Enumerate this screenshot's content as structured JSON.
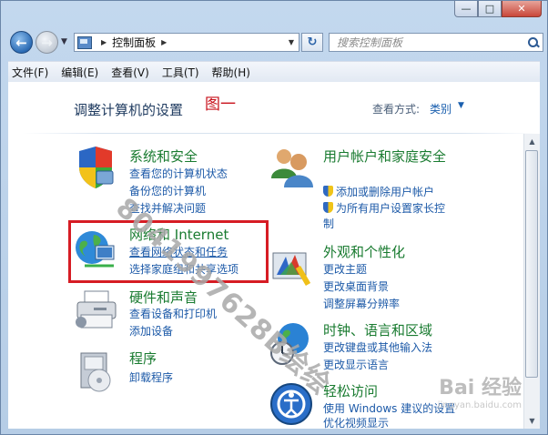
{
  "window": {
    "caption_buttons": [
      "—",
      "□",
      "✕"
    ]
  },
  "nav": {
    "back_icon": "back-arrow-icon",
    "forward_icon": "forward-arrow-icon",
    "address": "控制面板",
    "search_placeholder": "搜索控制面板"
  },
  "menu": [
    "文件(F)",
    "编辑(E)",
    "查看(V)",
    "工具(T)",
    "帮助(H)"
  ],
  "main": {
    "title": "调整计算机的设置",
    "figure_label": "图一",
    "view_by_label": "查看方式:",
    "view_by_value": "类别"
  },
  "categories_left": [
    {
      "title": "系统和安全",
      "icon": "shield-icon",
      "links": [
        "查看您的计算机状态",
        "备份您的计算机",
        "查找并解决问题"
      ]
    },
    {
      "title": "网络和 Internet",
      "icon": "network-globe-icon",
      "links": [
        "查看网络状态和任务",
        "选择家庭组和共享选项"
      ]
    },
    {
      "title": "硬件和声音",
      "icon": "printer-icon",
      "links": [
        "查看设备和打印机",
        "添加设备"
      ]
    },
    {
      "title": "程序",
      "icon": "programs-icon",
      "links": [
        "卸载程序"
      ]
    }
  ],
  "categories_right": [
    {
      "title": "用户帐户和家庭安全",
      "icon": "users-icon",
      "links": [
        "添加或删除用户帐户",
        "为所有用户设置家长控制"
      ]
    },
    {
      "title": "外观和个性化",
      "icon": "appearance-icon",
      "links": [
        "更改主题",
        "更改桌面背景",
        "调整屏幕分辨率"
      ]
    },
    {
      "title": "时钟、语言和区域",
      "icon": "clock-globe-icon",
      "links": [
        "更改键盘或其他输入法",
        "更改显示语言"
      ]
    },
    {
      "title": "轻松访问",
      "icon": "ease-of-access-icon",
      "links": [
        "使用 Windows 建议的设置",
        "优化视频显示"
      ]
    }
  ],
  "watermark": {
    "diagonal": "8041997628B绘绘",
    "baidu": "Bai 经验",
    "baidu_url": "jingyan.baidu.com"
  }
}
